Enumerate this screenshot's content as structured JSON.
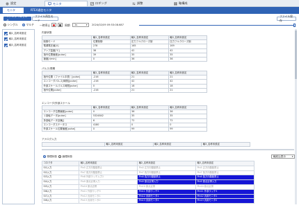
{
  "nav": {
    "tabs": [
      {
        "label": "設定",
        "icon": "gear-icon"
      },
      {
        "label": "モニタ",
        "icon": "monitor-icon"
      },
      {
        "label": "ロギング",
        "icon": "logging-icon"
      },
      {
        "label": "調整",
        "icon": "adjust-icon"
      },
      {
        "label": "軸構成",
        "icon": "axis-config-icon"
      }
    ]
  },
  "subtabs": [
    "モニタ",
    "RTEX通信モニタ"
  ],
  "toolbar": {
    "mode_buttons": [
      "リアルタイムモニタ",
      "ファイル再生モード"
    ],
    "file_button": "ファイル保存"
  },
  "controls": {
    "radio_single": "シングル",
    "radio_multi": "マルチ",
    "pause_label": "一時停止",
    "period_label": "周期",
    "period_value": "1s",
    "timestamp": "2024/02/09 09:53:08.687",
    "filter_value": "軸数1表示"
  },
  "left_panel": {
    "items": [
      "軸1_名称未設定",
      "軸2_名称未設定",
      "軸3_名称未設定"
    ]
  },
  "table1": {
    "title": "内部状態",
    "headers": [
      "",
      "軸1_名称未設定",
      "軸2_名称未設定",
      "軸3_名称未設定"
    ],
    "rows": [
      [
        "制御モード",
        "位置制御",
        "圧力フルクローズ制",
        "圧力フルクローズ制"
      ],
      [
        "電源電圧値[V]",
        "278",
        "165",
        "169"
      ],
      [
        "アンプ温度[℃]",
        "38",
        "42",
        "42"
      ],
      [
        "指令位置偏差[pulse]",
        "39",
        "35",
        "35"
      ],
      [
        "速度[r/min]",
        "0",
        "36",
        "36"
      ]
    ]
  },
  "table2": {
    "title": "パルス/周期",
    "headers": [
      "",
      "軸1_名称未設定",
      "軸2_名称未設定",
      "軸3_名称未設定"
    ],
    "rows": [
      [
        "指令位置（ファイル中表）[pulse]",
        "-216",
        "21",
        "21"
      ],
      [
        "エンコーダパルス[時間][pulse]",
        "-216",
        "42",
        "42"
      ],
      [
        "外部スケールパルス時間[pulse]",
        "0",
        "18",
        "18"
      ],
      [
        "指令位置[pulse]",
        "-216",
        "21",
        "21"
      ]
    ]
  },
  "table3": {
    "title": "エンコーダ/外部スケール",
    "headers": [
      "",
      "軸1_名称未設定",
      "軸2_名称未設定",
      "軸3_名称未設定"
    ],
    "rows": [
      [
        "エンコーダ位置偏差[pulse]",
        "0",
        "36",
        "36"
      ],
      [
        "１回転データ[pulse]",
        "5324842",
        "35",
        "35"
      ],
      [
        "多回転データ[回転]",
        "6",
        "72",
        "72"
      ],
      [
        "エンコーダステータス",
        "4180",
        "0",
        "0"
      ],
      [
        "外部スケール位置偏差[pulse]",
        "0",
        "99",
        "99"
      ]
    ]
  },
  "table4": {
    "title": "アナログ入力",
    "headers": [
      "",
      "軸1_名称未設定",
      "軸2_名称未設定",
      "軸3_名称未設定"
    ]
  },
  "io": {
    "radio_physical": "物理状態",
    "radio_logical": "論理状態",
    "dropdown": "軸絞込表示",
    "headers": [
      "コネクタ",
      "軸1_名称未設定",
      "軸2_名称未設定",
      "軸3_名称未設定"
    ],
    "rows": [
      [
        "SI1入力",
        "Pin5 正方向駆動禁止",
        "Pin5 正方向駆動禁止",
        "Pin5 正方向駆動禁止"
      ],
      [
        "SI2入力",
        "Pin7 負方向駆動禁止",
        "Pin7 負方向駆動禁止",
        "Pin7 負方向駆動禁止"
      ],
      [
        "SI3入力",
        "Pin8 外部ラッチ入力1",
        "Pin8 負方向駆動禁止",
        "Pin8 負方向駆動禁止"
      ],
      [
        "SI4入力",
        "Pin9 原点近傍入力",
        "Pin9 原点近傍入力",
        "Pin9 原点近傍入力"
      ],
      [
        "SI5入力",
        "Pin10 原点近傍",
        "Pin10 原点近傍",
        "Pin10 原点近傍"
      ],
      [
        "SI6入力",
        "Pin11 外部ラッチ3",
        "Pin11 外部ラッチ3",
        "Pin11 外部ラッチ3"
      ],
      [
        "SI7入力",
        "Pin12 汎用モニタ1",
        "Pin12 汎用モニタ1",
        "Pin12 汎用モニタ1"
      ],
      [
        "SI8入力",
        "Pin13 汎用モニタ2",
        "Pin13 汎用モニタ2",
        "Pin13 汎用モニタ2"
      ]
    ]
  },
  "colors": {
    "accent": "#2f63b5",
    "highlight": "#1515d6"
  }
}
